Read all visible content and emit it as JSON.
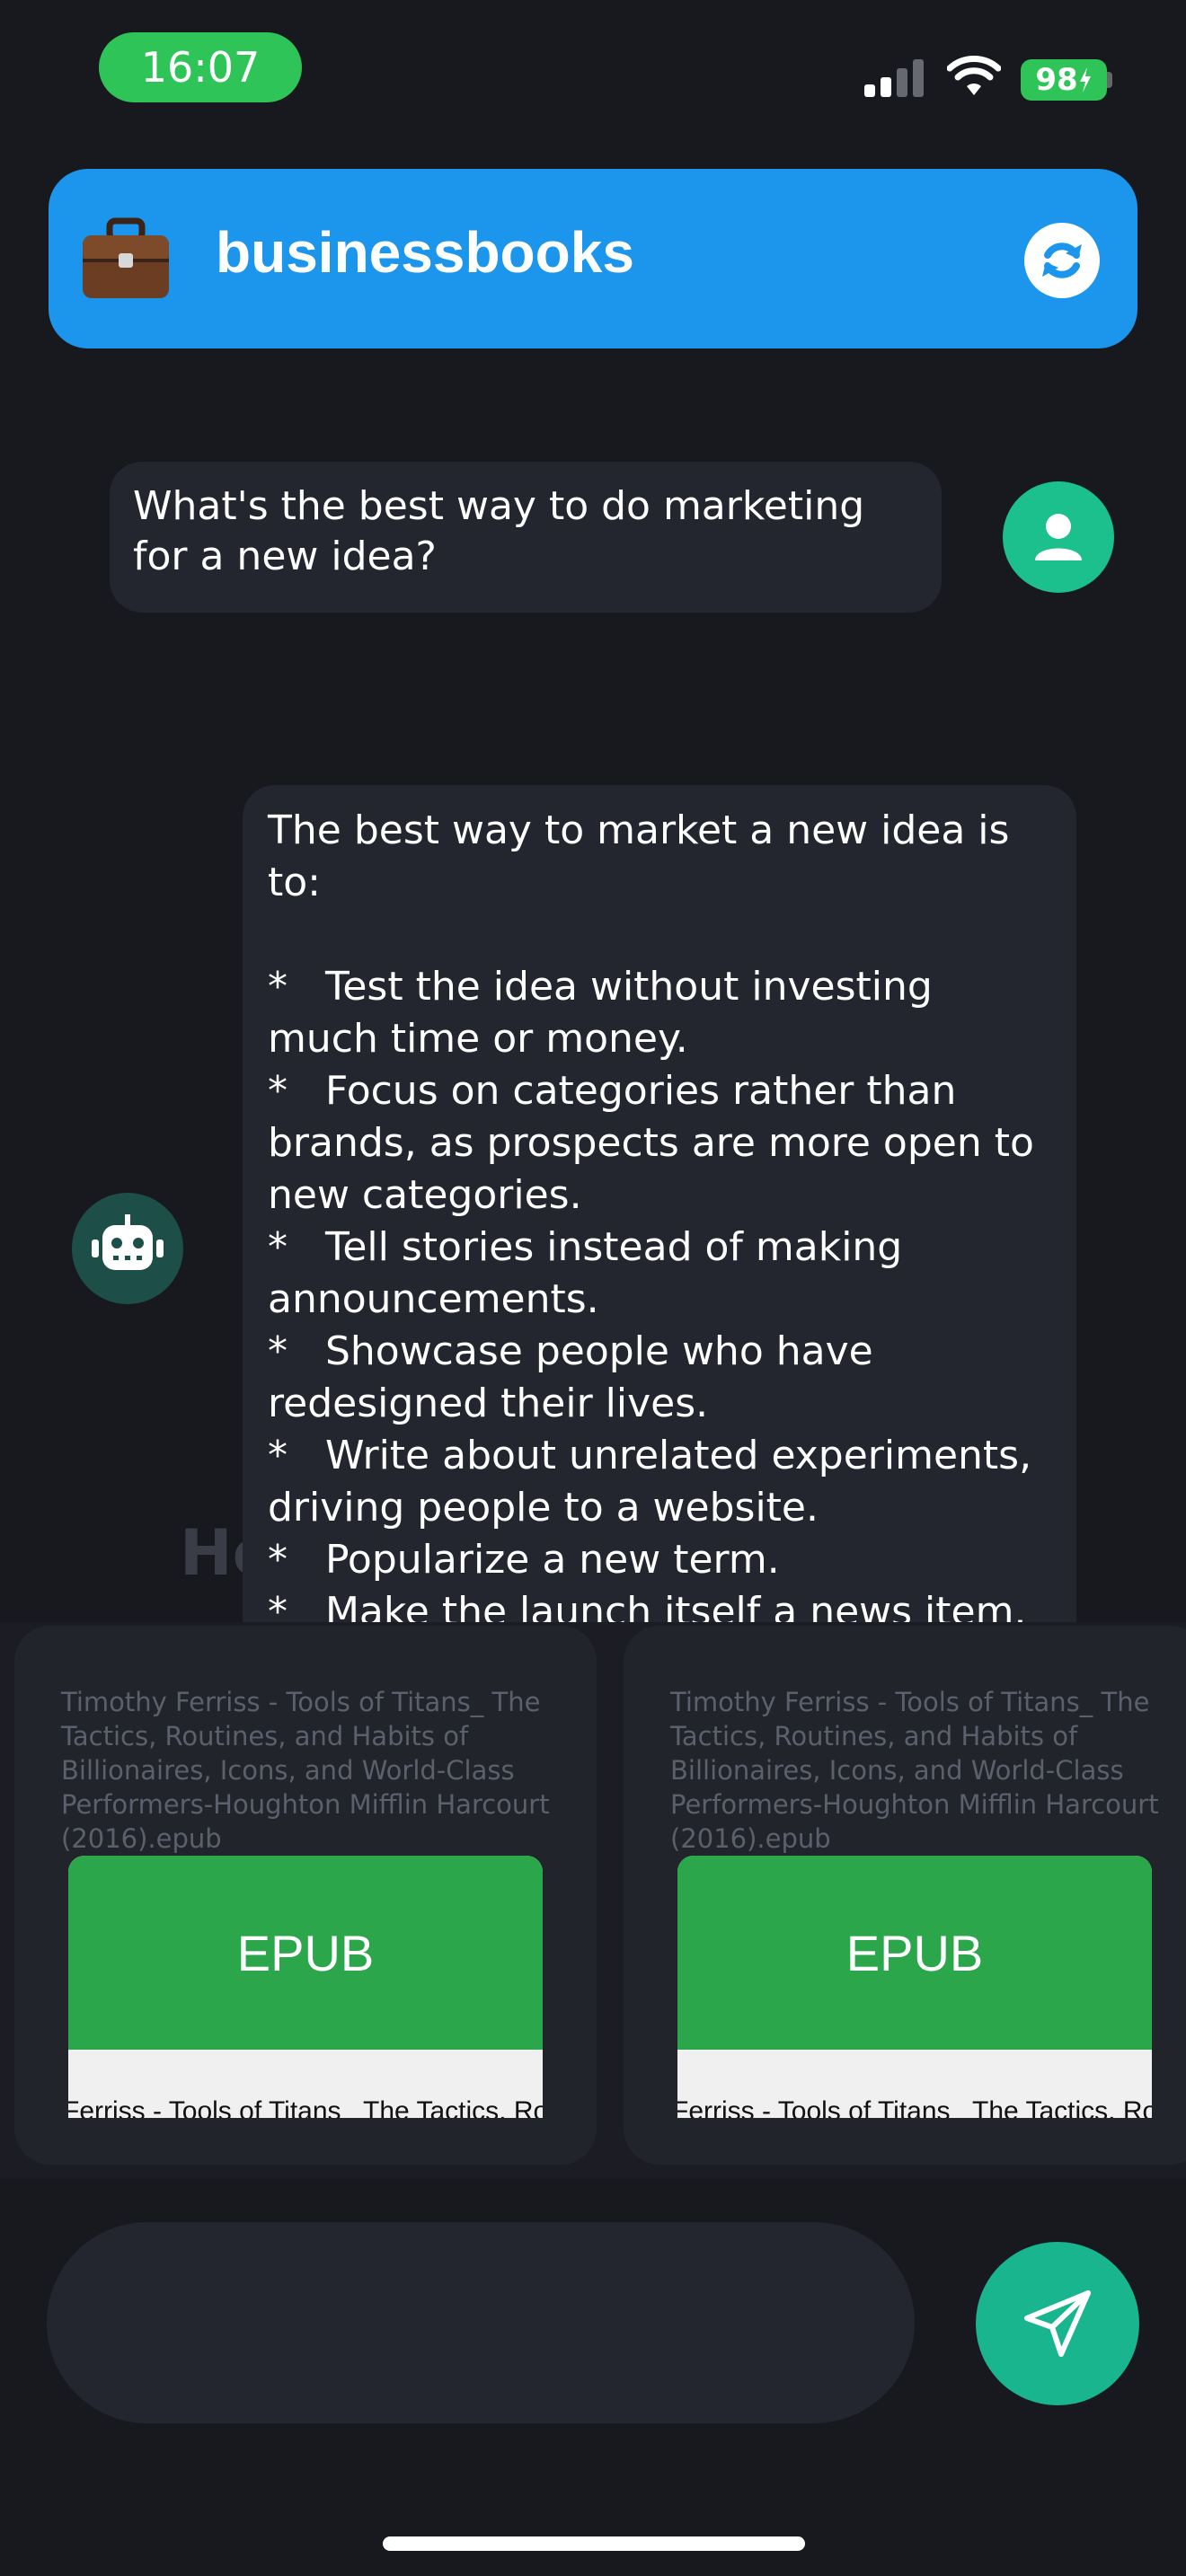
{
  "status_bar": {
    "time": "16:07",
    "battery": "98"
  },
  "header": {
    "title": "businessbooks",
    "icon": "briefcase-icon"
  },
  "messages": {
    "user": "What's the best way to do marketing for a new idea?",
    "bot": "The best way to market a new idea is to:\n\n*   Test the idea without investing much time or money.\n*   Focus on categories rather than brands, as prospects are more open to new categories.\n*   Tell stories instead of making announcements.\n*   Showcase people who have redesigned their lives.\n*   Write about unrelated experiments, driving people to a website.\n*   Popularize a new term.\n*   Make the launch itself a news item."
  },
  "background_text": "Ho",
  "sources": [
    {
      "title": "Timothy Ferriss - Tools of Titans_ The Tactics, Routines, and Habits of Billionaires, Icons, and World-Class Performers-Houghton Mifflin Harcourt (2016).epub",
      "badge": "EPUB",
      "caption": "Ferriss - Tools of Titans_ The Tactics, Rout"
    },
    {
      "title": "Timothy Ferriss - Tools of Titans_ The Tactics, Routines, and Habits of Billionaires, Icons, and World-Class Performers-Houghton Mifflin Harcourt (2016).epub",
      "badge": "EPUB",
      "caption": "Ferriss - Tools of Titans_ The Tactics, Rout"
    }
  ],
  "input": {
    "placeholder": ""
  },
  "colors": {
    "header": "#1c95ec",
    "accent": "#19b58f",
    "status_green": "#2fc457",
    "epub_green": "#2ba64a"
  }
}
